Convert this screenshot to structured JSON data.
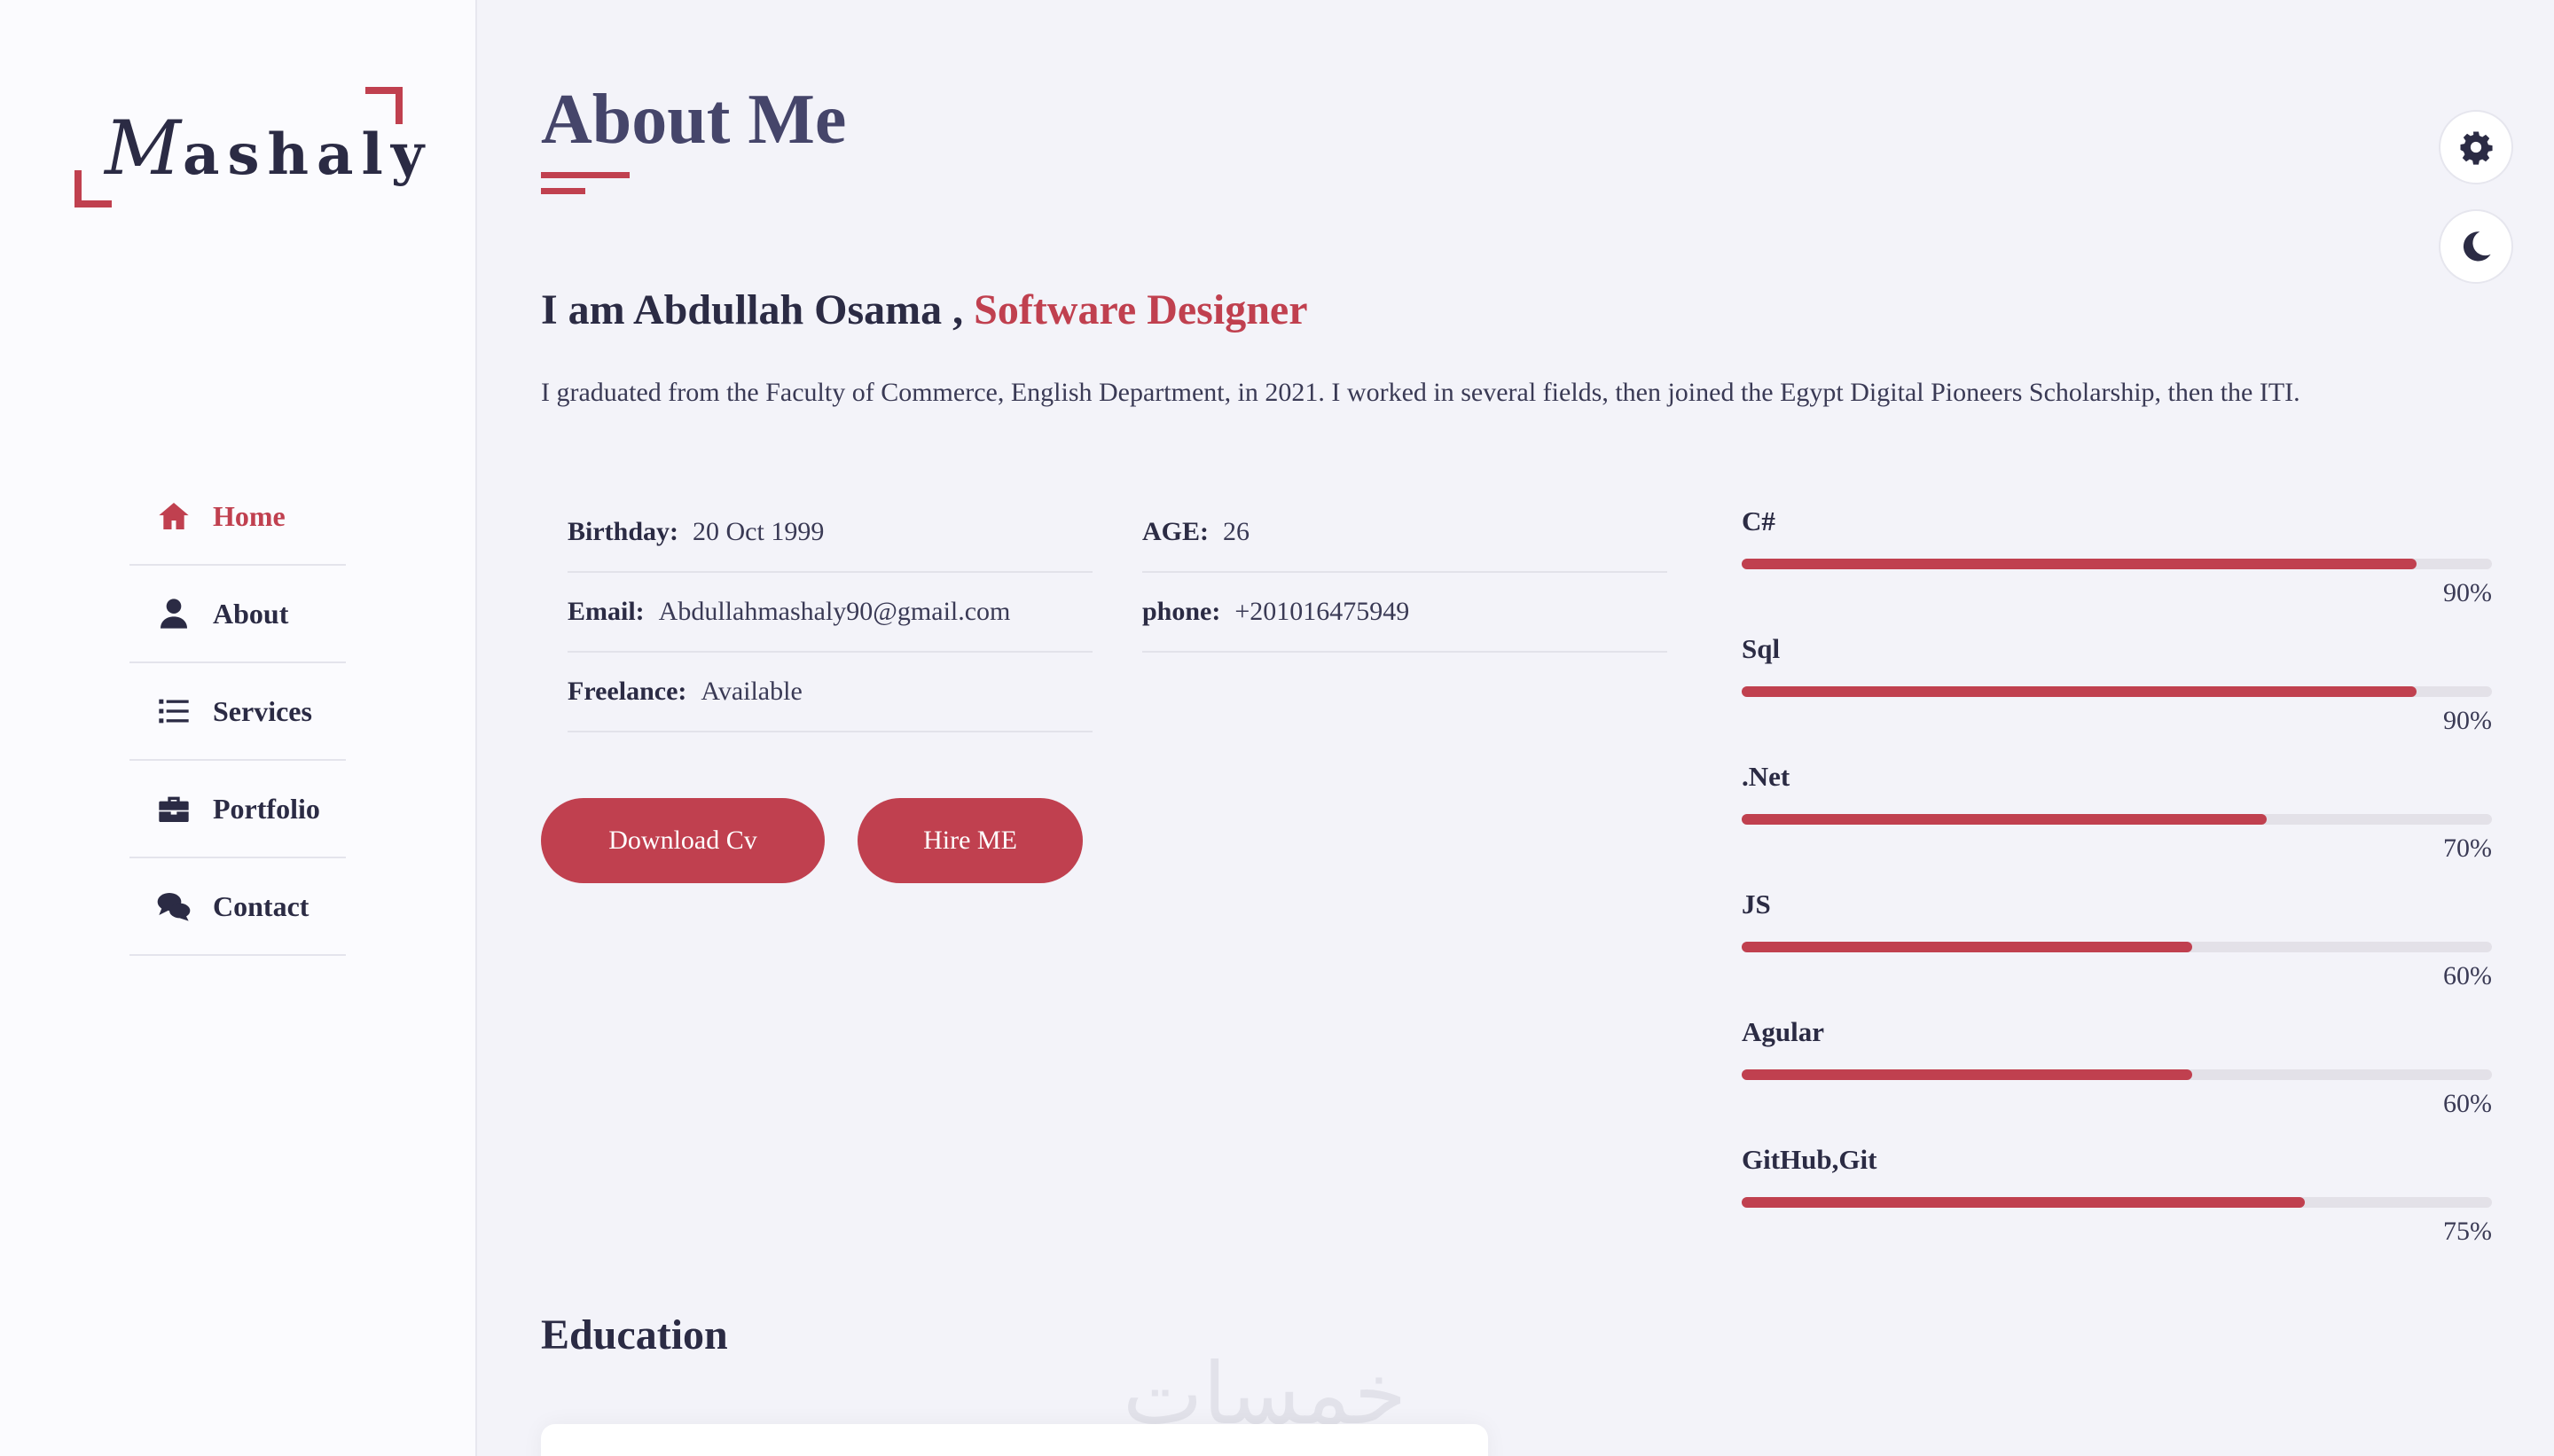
{
  "logo": {
    "initial": "M",
    "rest": "ashaly"
  },
  "nav": {
    "items": [
      {
        "label": "Home",
        "icon": "home-icon",
        "active": true
      },
      {
        "label": "About",
        "icon": "user-icon"
      },
      {
        "label": "Services",
        "icon": "list-icon"
      },
      {
        "label": "Portfolio",
        "icon": "briefcase-icon"
      },
      {
        "label": "Contact",
        "icon": "comments-icon"
      }
    ]
  },
  "page": {
    "title": "About Me"
  },
  "intro": {
    "prefix": "I am Abdullah Osama , ",
    "role": "Software Designer"
  },
  "description": "I graduated from the Faculty of Commerce, English Department, in 2021. I worked in several fields, then joined the Egypt Digital Pioneers Scholarship, then the ITI.",
  "info": {
    "birthday": {
      "label": "Birthday:",
      "value": "20 Oct 1999"
    },
    "email": {
      "label": "Email:",
      "value": "Abdullahmashaly90@gmail.com"
    },
    "freelance": {
      "label": "Freelance:",
      "value": "Available"
    },
    "age": {
      "label": "AGE:",
      "value": "26"
    },
    "phone": {
      "label": "phone:",
      "value": "+201016475949"
    }
  },
  "buttons": {
    "download": "Download Cv",
    "hire": "Hire ME"
  },
  "skills": [
    {
      "name": "C#",
      "percent": 90,
      "label": "90%"
    },
    {
      "name": "Sql",
      "percent": 90,
      "label": "90%"
    },
    {
      "name": ".Net",
      "percent": 70,
      "label": "70%"
    },
    {
      "name": "JS",
      "percent": 60,
      "label": "60%"
    },
    {
      "name": "Agular",
      "percent": 60,
      "label": "60%"
    },
    {
      "name": "GitHub,Git",
      "percent": 75,
      "label": "75%"
    }
  ],
  "education": {
    "title": "Education"
  },
  "watermark": "خمسات",
  "colors": {
    "accent": "#c0404f",
    "background": "#f3f3f9",
    "sidebar": "#fbfbfe",
    "text": "#2b2b44"
  },
  "icons": {
    "settings": "gear-icon",
    "theme": "moon-icon"
  }
}
